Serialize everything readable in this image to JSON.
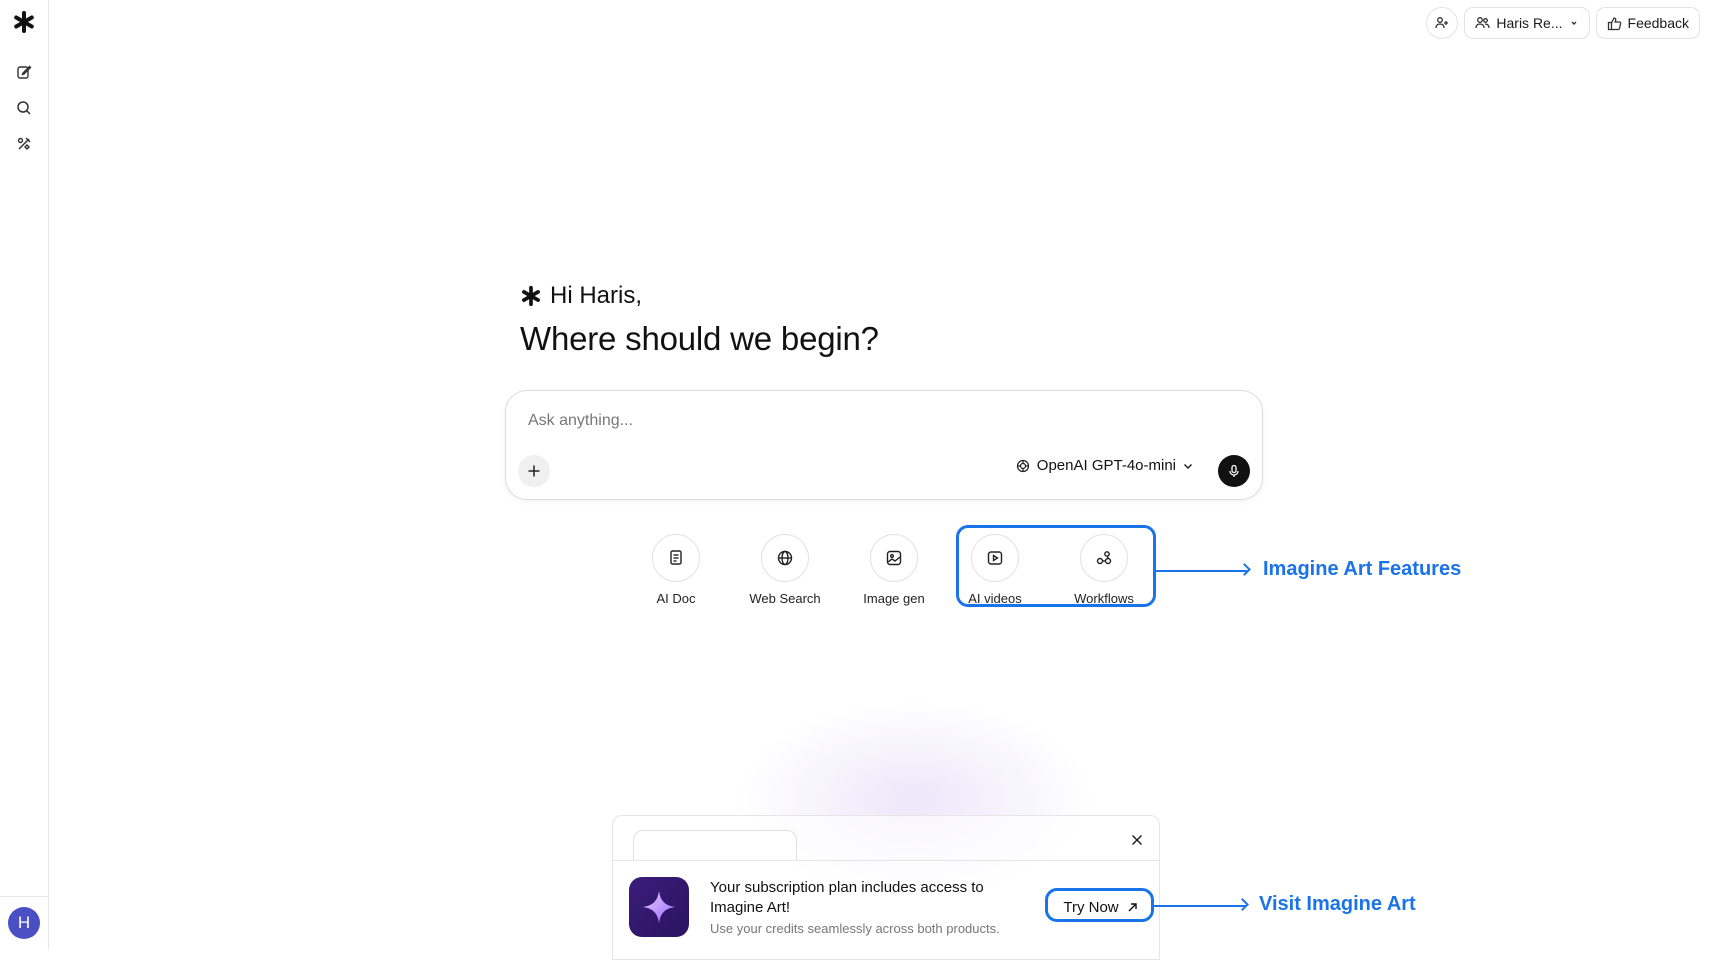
{
  "sidebar": {
    "avatar_initial": "H",
    "items": [
      {
        "name": "new-chat",
        "icon": "edit-icon"
      },
      {
        "name": "search",
        "icon": "search-icon"
      },
      {
        "name": "tools",
        "icon": "tools-icon"
      }
    ]
  },
  "topbar": {
    "account_label": "Haris Re...",
    "feedback_label": "Feedback"
  },
  "greeting": {
    "hello": "Hi Haris,",
    "headline": "Where should we begin?"
  },
  "composer": {
    "placeholder": "Ask anything...",
    "model_label": "OpenAI GPT-4o-mini"
  },
  "features": [
    {
      "label": "AI Doc",
      "icon": "doc-icon"
    },
    {
      "label": "Web Search",
      "icon": "globe-icon"
    },
    {
      "label": "Image gen",
      "icon": "image-icon"
    },
    {
      "label": "AI videos",
      "icon": "video-icon"
    },
    {
      "label": "Workflows",
      "icon": "workflow-icon"
    }
  ],
  "annotations": {
    "features_label": "Imagine Art Features",
    "visit_label": "Visit Imagine Art"
  },
  "promo": {
    "title": "Your subscription plan includes access to Imagine Art!",
    "subtitle": "Use your credits seamlessly across both products.",
    "cta_label": "Try Now"
  },
  "colors": {
    "accent": "#1a73e8",
    "avatar": "#4a4fc4",
    "app_icon": "#3a1c7a"
  }
}
